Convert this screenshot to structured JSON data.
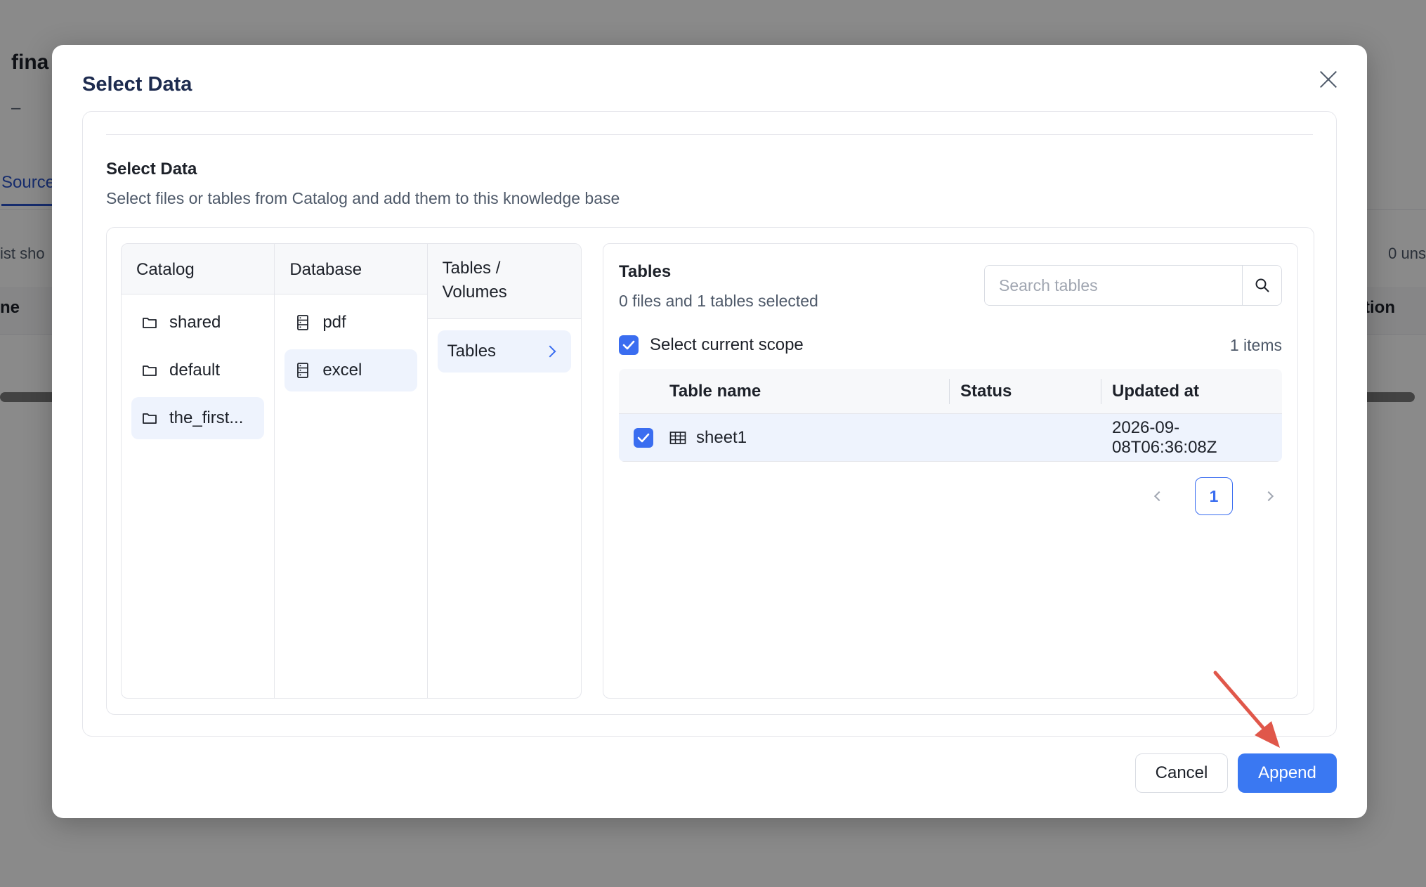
{
  "background": {
    "title_fragment": "fina",
    "dash": "–",
    "tab_fragment": "Source",
    "left_note_fragment": "ist sho",
    "right_note_fragment": "0 uns",
    "head_left_fragment": "ne",
    "head_right_fragment": "tion"
  },
  "modal": {
    "title": "Select Data",
    "section_title": "Select Data",
    "section_desc": "Select files or tables from Catalog and add them to this knowledge base"
  },
  "browser": {
    "catalog": {
      "header": "Catalog",
      "items": [
        {
          "label": "shared",
          "icon": "folder-icon",
          "active": false
        },
        {
          "label": "default",
          "icon": "folder-icon",
          "active": false
        },
        {
          "label": "the_first...",
          "icon": "folder-icon",
          "active": true
        }
      ]
    },
    "database": {
      "header": "Database",
      "items": [
        {
          "label": "pdf",
          "icon": "database-icon",
          "active": false
        },
        {
          "label": "excel",
          "icon": "database-icon",
          "active": true
        }
      ]
    },
    "tables_volumes": {
      "header": "Tables / Volumes",
      "items": [
        {
          "label": "Tables",
          "icon": "chevron-right-icon",
          "active": true
        }
      ]
    }
  },
  "tables_panel": {
    "title": "Tables",
    "selection_summary": "0 files and 1 tables selected",
    "search_placeholder": "Search tables",
    "select_scope_label": "Select current scope",
    "select_scope_checked": true,
    "items_count": "1 items",
    "columns": [
      "Table name",
      "Status",
      "Updated at"
    ],
    "rows": [
      {
        "checked": true,
        "name": "sheet1",
        "status": "",
        "updated_at": "2026-09-08T06:36:08Z"
      }
    ],
    "pagination": {
      "current_page": "1"
    }
  },
  "footer": {
    "cancel_label": "Cancel",
    "append_label": "Append"
  },
  "colors": {
    "primary": "#3a78f2",
    "annotation_arrow": "#e0574a",
    "selected_row": "#eef3fd"
  }
}
